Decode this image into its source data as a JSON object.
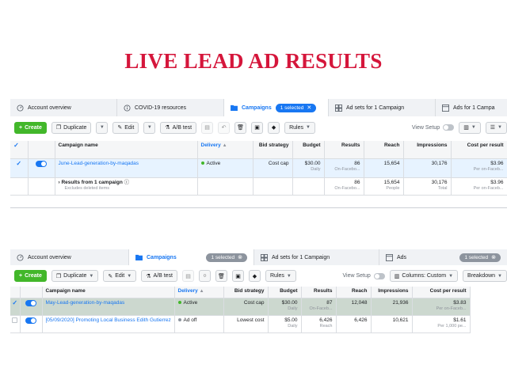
{
  "headline": "LIVE LEAD AD RESULTS",
  "colors": {
    "accent": "#1877f2",
    "create": "#42b72a",
    "headline": "#d5163b"
  },
  "shot1": {
    "tabs": [
      {
        "label": "Account overview",
        "icon": "gauge-icon"
      },
      {
        "label": "COVID-19 resources",
        "icon": "info-circle-icon"
      },
      {
        "label": "Campaigns",
        "icon": "folder-icon",
        "active": true,
        "pill": "1 selected"
      },
      {
        "label": "Ad sets for 1 Campaign",
        "icon": "grid-icon"
      },
      {
        "label": "Ads for 1 Campa",
        "icon": "ad-icon"
      }
    ],
    "toolbar": {
      "create": "Create",
      "duplicate": "Duplicate",
      "edit": "Edit",
      "ab_test": "A/B test",
      "rules": "Rules",
      "view_setup": "View Setup"
    },
    "columns": [
      "Campaign name",
      "Delivery",
      "Bid strategy",
      "Budget",
      "Results",
      "Reach",
      "Impressions",
      "Cost per result"
    ],
    "rows": [
      {
        "name": "June-Lead-generation-by-maqadas",
        "delivery": "Active",
        "bid": "Cost cap",
        "budget": "$30.00",
        "budget_sub": "Daily",
        "results": "86",
        "results_sub": "On-Facebo...",
        "reach": "15,654",
        "impressions": "30,176",
        "cpr": "$3.96",
        "cpr_sub": "Per on-Faceb..."
      }
    ],
    "summary": {
      "label": "Results from 1 campaign",
      "sub": "Excludes deleted items",
      "results": "86",
      "results_sub": "On-Facebo...",
      "reach": "15,654",
      "reach_sub": "People",
      "impressions": "30,176",
      "impressions_sub": "Total",
      "cpr": "$3.96",
      "cpr_sub": "Per on-Faceb..."
    }
  },
  "shot2": {
    "tabs": [
      {
        "label": "Account overview",
        "icon": "gauge-icon"
      },
      {
        "label": "Campaigns",
        "icon": "folder-icon",
        "active": true,
        "pill": "1 selected"
      },
      {
        "label": "Ad sets for 1 Campaign",
        "icon": "grid-icon"
      },
      {
        "label": "Ads",
        "icon": "ad-icon",
        "pill": "1 selected"
      }
    ],
    "toolbar": {
      "create": "Create",
      "duplicate": "Duplicate",
      "edit": "Edit",
      "ab_test": "A/B test",
      "rules": "Rules",
      "view_setup": "View Setup",
      "columns": "Columns: Custom",
      "breakdown": "Breakdown"
    },
    "columns": [
      "Campaign name",
      "Delivery",
      "Bid strategy",
      "Budget",
      "Results",
      "Reach",
      "Impressions",
      "Cost per result"
    ],
    "rows": [
      {
        "name": "May-Lead-generation-by-maqadas",
        "delivery": "Active",
        "delivery_color": "green",
        "bid": "Cost cap",
        "budget": "$30.00",
        "budget_sub": "Daily",
        "results": "87",
        "results_sub": "On-Faceb...",
        "reach": "12,048",
        "reach_sub": "",
        "impressions": "21,936",
        "cpr": "$3.83",
        "cpr_sub": "Per on-Faceb..."
      },
      {
        "name": "[05/09/2020] Promoting Local Business Edith Gutierrez",
        "delivery": "Ad off",
        "delivery_color": "grey",
        "bid": "Lowest cost",
        "budget": "$5.00",
        "budget_sub": "Daily",
        "results": "6,426",
        "results_sub": "Reach",
        "reach": "6,426",
        "reach_sub": "",
        "impressions": "10,621",
        "cpr": "$1.61",
        "cpr_sub": "Per 1,000 pe..."
      }
    ]
  }
}
